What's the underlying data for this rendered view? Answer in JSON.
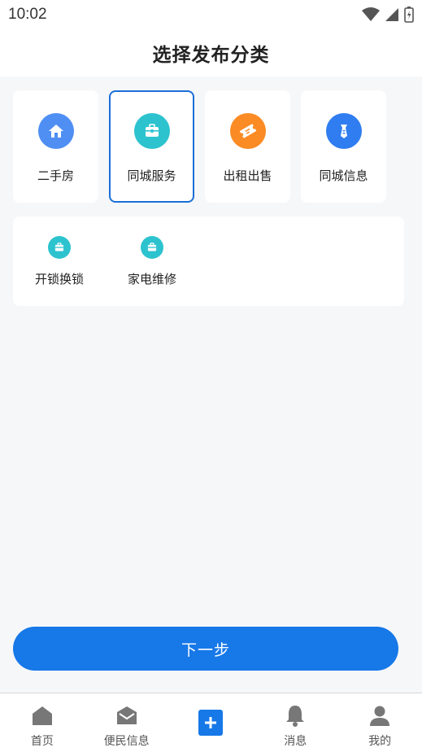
{
  "status_bar": {
    "time": "10:02"
  },
  "header": {
    "title": "选择发布分类"
  },
  "categories": [
    {
      "label": "二手房",
      "icon": "house-icon",
      "color": "#4f8ff4",
      "selected": false
    },
    {
      "label": "同城服务",
      "icon": "toolbox-icon",
      "color": "#2cc3cf",
      "selected": true
    },
    {
      "label": "出租出售",
      "icon": "ticket-icon",
      "color": "#fb8b24",
      "selected": false
    },
    {
      "label": "同城信息",
      "icon": "tie-icon",
      "color": "#2f7df0",
      "selected": false
    }
  ],
  "subcategories": [
    {
      "label": "开锁换锁",
      "icon": "toolbox-icon"
    },
    {
      "label": "家电维修",
      "icon": "toolbox-icon"
    }
  ],
  "next_button": {
    "label": "下一步"
  },
  "colors": {
    "accent": "#1778e8",
    "selected_border": "#1b6fd8",
    "tab_icon": "#777777"
  },
  "tabbar": {
    "items": [
      {
        "label": "首页",
        "icon": "home-icon"
      },
      {
        "label": "便民信息",
        "icon": "mail-icon"
      },
      {
        "label": "",
        "icon": "add-icon"
      },
      {
        "label": "消息",
        "icon": "bell-icon"
      },
      {
        "label": "我的",
        "icon": "user-icon"
      }
    ]
  }
}
